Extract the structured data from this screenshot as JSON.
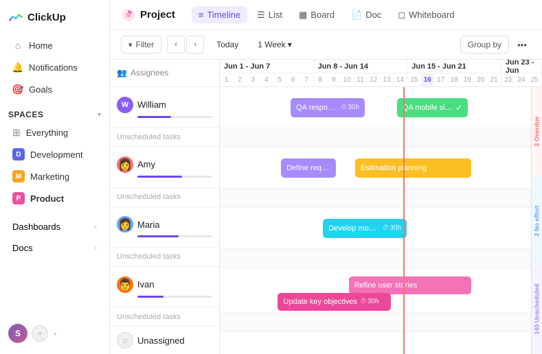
{
  "app": {
    "logo_text": "ClickUp"
  },
  "sidebar": {
    "nav_items": [
      {
        "id": "home",
        "label": "Home",
        "icon": "⌂"
      },
      {
        "id": "notifications",
        "label": "Notifications",
        "icon": "🔔"
      },
      {
        "id": "goals",
        "label": "Goals",
        "icon": "🎯"
      }
    ],
    "spaces_label": "Spaces",
    "spaces": [
      {
        "id": "everything",
        "label": "Everything",
        "icon": "⊞",
        "color": null,
        "abbr": null
      },
      {
        "id": "development",
        "label": "Development",
        "color": "#5b67e8",
        "abbr": "D"
      },
      {
        "id": "marketing",
        "label": "Marketing",
        "color": "#f5a623",
        "abbr": "M"
      },
      {
        "id": "product",
        "label": "Product",
        "color": "#e854a0",
        "abbr": "P",
        "bold": true
      }
    ],
    "collapse_items": [
      {
        "id": "dashboards",
        "label": "Dashboards"
      },
      {
        "id": "docs",
        "label": "Docs"
      }
    ],
    "footer": {
      "avatar_label": "S"
    }
  },
  "header": {
    "project_icon": "🔷",
    "project_name": "Project",
    "tabs": [
      {
        "id": "timeline",
        "label": "Timeline",
        "icon": "≡",
        "active": true
      },
      {
        "id": "list",
        "label": "List",
        "icon": "☰"
      },
      {
        "id": "board",
        "label": "Board",
        "icon": "▦"
      },
      {
        "id": "doc",
        "label": "Doc",
        "icon": "📄"
      },
      {
        "id": "whiteboard",
        "label": "Whiteboard",
        "icon": "◻"
      }
    ]
  },
  "toolbar": {
    "filter_label": "Filter",
    "today_label": "Today",
    "week_label": "1 Week",
    "group_by_label": "Group by"
  },
  "gantt": {
    "assignees_label": "Assignees",
    "date_groups": [
      {
        "label": "Jun 1 - Jun 7",
        "days": [
          "1",
          "2",
          "3",
          "4",
          "5",
          "6",
          "7"
        ]
      },
      {
        "label": "Jun 8 - Jun 14",
        "days": [
          "8",
          "9",
          "10",
          "11",
          "12",
          "13",
          "14"
        ]
      },
      {
        "label": "Jun 15 - Jun 21",
        "days": [
          "15",
          "16",
          "17",
          "18",
          "19",
          "20",
          "21"
        ],
        "today_day": "16"
      },
      {
        "label": "Jun 23 - Jun",
        "days": [
          "23",
          "24",
          "25"
        ]
      }
    ],
    "rows": [
      {
        "id": "william",
        "name": "William",
        "avatar_bg": "#8b5cf6",
        "progress": 45,
        "tasks": [
          {
            "id": "t1",
            "label": "QA responsive breakpoints",
            "time": "30h",
            "color": "#a78bfa",
            "left_pct": 27,
            "width_pct": 22
          },
          {
            "id": "t2",
            "label": "QA mobile signup..",
            "color": "#4ade80",
            "left_pct": 55,
            "width_pct": 18,
            "has_icon": true
          }
        ]
      },
      {
        "id": "amy",
        "name": "Amy",
        "avatar_bg": "#f87171",
        "progress": 60,
        "tasks": [
          {
            "id": "t3",
            "label": "Define requirements",
            "color": "#a78bfa",
            "left_pct": 22,
            "width_pct": 15
          },
          {
            "id": "t4",
            "label": "Estimation planning",
            "color": "#fbbf24",
            "left_pct": 45,
            "width_pct": 30
          }
        ]
      },
      {
        "id": "maria",
        "name": "Maria",
        "avatar_bg": "#60a5fa",
        "progress": 55,
        "tasks": [
          {
            "id": "t5",
            "label": "Develop mobile app",
            "time": "30h",
            "color": "#22d3ee",
            "left_pct": 33,
            "width_pct": 22
          }
        ]
      },
      {
        "id": "ivan",
        "name": "Ivan",
        "avatar_bg": "#f97316",
        "progress": 35,
        "tasks": [
          {
            "id": "t6",
            "label": "Refine user stories",
            "color": "#f472b6",
            "left_pct": 42,
            "width_pct": 35
          },
          {
            "id": "t7",
            "label": "Update key objectives",
            "time": "30h",
            "color": "#ec4899",
            "left_pct": 22,
            "width_pct": 30
          }
        ]
      }
    ],
    "unassigned_label": "Unassigned",
    "right_labels": [
      {
        "id": "overdue",
        "label": "3 Overdue",
        "color": "#f87171",
        "bg": "#fff5f5"
      },
      {
        "id": "no-effort",
        "label": "2 No effort",
        "color": "#60a5fa",
        "bg": "#eff6ff"
      },
      {
        "id": "unscheduled",
        "label": "140 Unscheduled",
        "color": "#a78bfa",
        "bg": "#f5f3ff"
      }
    ],
    "unscheduled_label": "Unscheduled tasks",
    "today_line_left_pct": 57
  }
}
